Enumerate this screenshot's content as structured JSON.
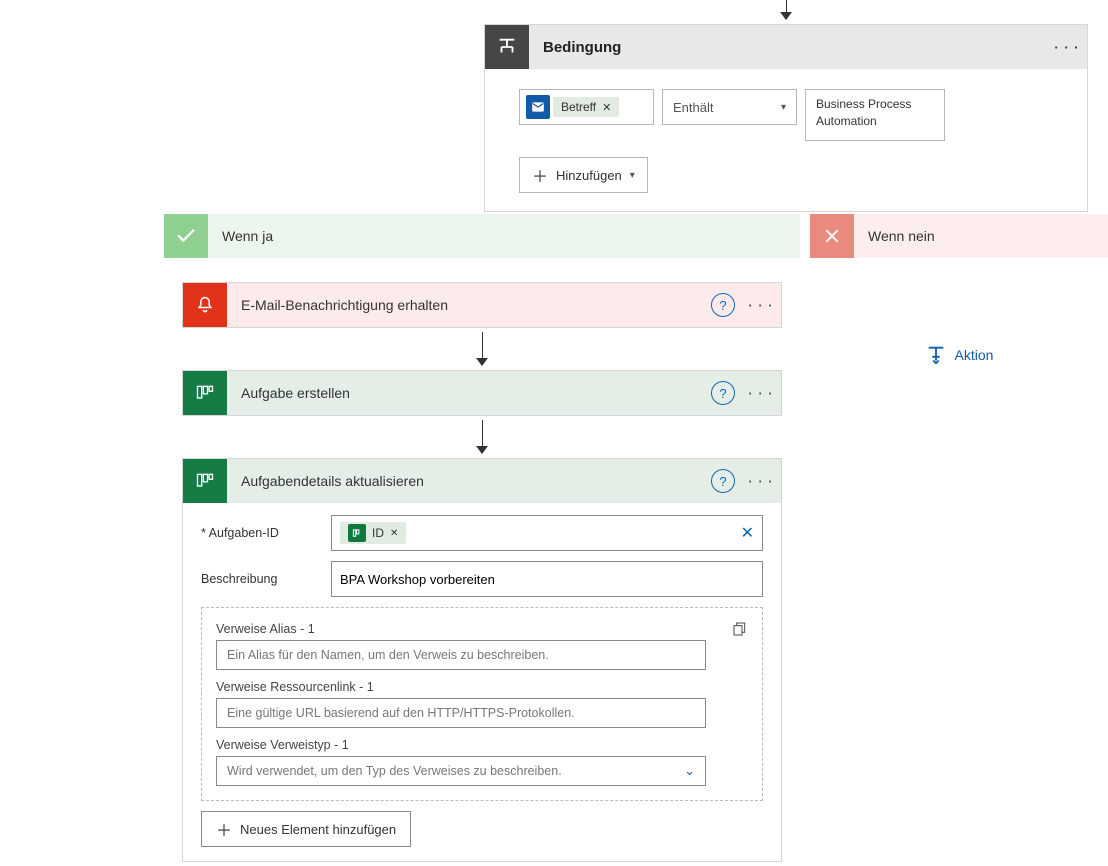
{
  "condition": {
    "title": "Bedingung",
    "left_token": "Betreff",
    "operator": "Enthält",
    "value": "Business Process Automation",
    "add_button": "Hinzufügen"
  },
  "branches": {
    "yes": {
      "title": "Wenn ja"
    },
    "no": {
      "title": "Wenn nein",
      "add_action": "Aktion"
    }
  },
  "actions": {
    "notify": {
      "title": "E-Mail-Benachrichtigung erhalten"
    },
    "create_task": {
      "title": "Aufgabe erstellen"
    },
    "update_details": {
      "title": "Aufgabendetails aktualisieren",
      "fields": {
        "task_id_label": "Aufgaben-ID",
        "task_id_token": "ID",
        "description_label": "Beschreibung",
        "description_value": "BPA Workshop vorbereiten",
        "ref_alias_label": "Verweise Alias - 1",
        "ref_alias_placeholder": "Ein Alias für den Namen, um den Verweis zu beschreiben.",
        "ref_url_label": "Verweise Ressourcenlink - 1",
        "ref_url_placeholder": "Eine gültige URL basierend auf den HTTP/HTTPS-Protokollen.",
        "ref_type_label": "Verweise Verweistyp - 1",
        "ref_type_placeholder": "Wird verwendet, um den Typ des Verweises zu beschreiben.",
        "add_element": "Neues Element hinzufügen"
      }
    }
  }
}
